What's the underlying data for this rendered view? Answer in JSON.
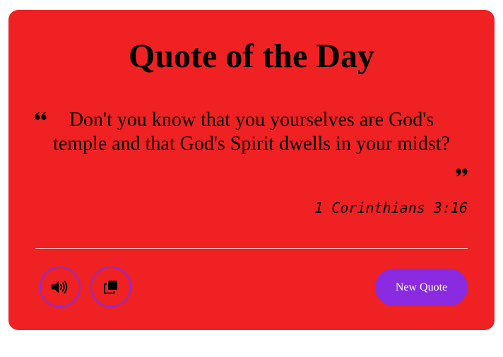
{
  "card": {
    "title": "Quote of the Day",
    "quote": "Don't you know that you yourselves are God's temple and that God's Spirit dwells in your midst?",
    "author": "1 Corinthians 3:16"
  },
  "actions": {
    "speak_icon": "volume-icon",
    "copy_icon": "copy-icon",
    "new_quote_label": "New Quote"
  },
  "colors": {
    "card_background": "#ef2122",
    "accent": "#8a2be2",
    "text": "#000000",
    "button_text": "#ffffff"
  }
}
